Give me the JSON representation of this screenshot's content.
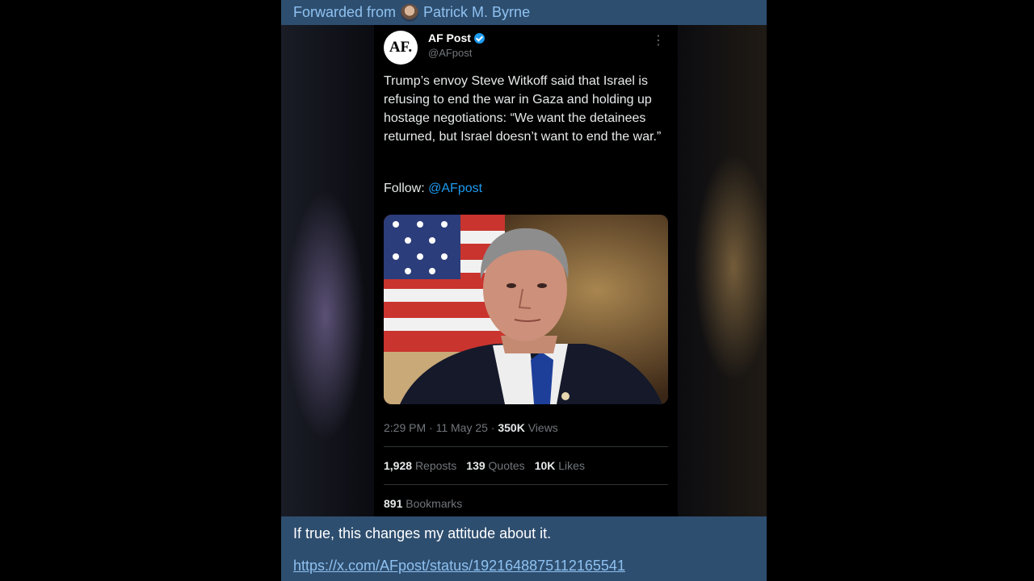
{
  "forward": {
    "prefix": "Forwarded from",
    "author": "Patrick M. Byrne"
  },
  "tweet": {
    "avatar_text": "AF.",
    "name": "AF Post",
    "handle": "@AFpost",
    "text": "Trump’s envoy Steve Witkoff said that Israel is refusing to end the war in Gaza and holding up hostage negotiations: “We want the detainees returned, but Israel doesn’t want to end the war.”",
    "follow_label": "Follow:",
    "follow_link": "@AFpost",
    "time": "2:29 PM · 11 May 25 · ",
    "views_count": "350K",
    "views_label": " Views",
    "reposts_count": "1,928",
    "reposts_label": "Reposts",
    "quotes_count": "139",
    "quotes_label": "Quotes",
    "likes_count": "10K",
    "likes_label": "Likes",
    "bookmarks_count": "891",
    "bookmarks_label": "Bookmarks"
  },
  "caption": {
    "text": "If true, this changes my attitude about it.",
    "link": "https://x.com/AFpost/status/1921648875112165541"
  },
  "colors": {
    "telegram_bubble": "#2e4e6f",
    "link": "#8ec1f0",
    "twitter_blue": "#1d9bf0"
  },
  "icons": [
    "verified-badge-icon",
    "more-options-icon"
  ]
}
